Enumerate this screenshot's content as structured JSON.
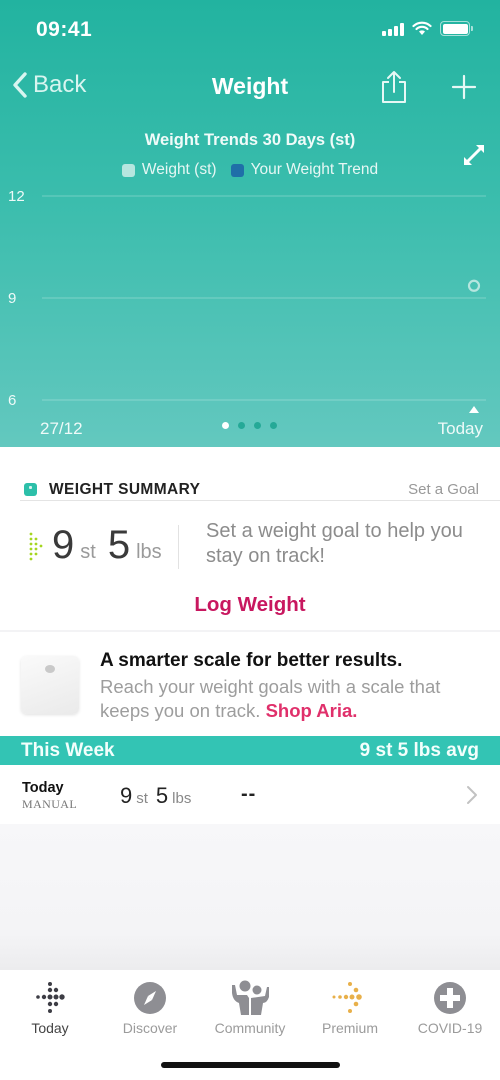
{
  "status_bar": {
    "time": "09:41"
  },
  "nav": {
    "back_label": "Back",
    "title": "Weight",
    "icons": {
      "back": "chevron-left-icon",
      "share": "share-icon",
      "add": "plus-icon"
    }
  },
  "chart_data": {
    "type": "scatter",
    "title": "Weight Trends 30 Days (st)",
    "legend": [
      {
        "name": "Weight (st)",
        "color": "#b6e6df"
      },
      {
        "name": "Your Weight Trend",
        "color": "#1f6fa8"
      }
    ],
    "legend_placement": "top",
    "xlabel": "",
    "ylabel": "",
    "x_ticks": [
      "27/12",
      "Today"
    ],
    "y_ticks": [
      12,
      9,
      6
    ],
    "ylim": [
      6,
      12
    ],
    "grid": true,
    "series": [
      {
        "name": "Weight (st)",
        "points": [
          {
            "x": "Today",
            "y": 9.36
          }
        ]
      },
      {
        "name": "Your Weight Trend",
        "points": []
      }
    ],
    "pages": 4,
    "active_page": 1
  },
  "summary": {
    "title": "WEIGHT SUMMARY",
    "set_goal": "Set a Goal",
    "stones": "9",
    "stones_unit": "st",
    "pounds": "5",
    "pounds_unit": "lbs",
    "goal_message": "Set a weight goal to help you stay on track!",
    "log_weight": "Log Weight"
  },
  "promo": {
    "title": "A smarter scale for better results.",
    "body": "Reach your weight goals with a scale that keeps you on track.",
    "link": "Shop Aria."
  },
  "week": {
    "label": "This Week",
    "average": "9 st 5 lbs avg"
  },
  "entries": [
    {
      "day": "Today",
      "source": "MANUAL",
      "stones": "9",
      "stones_unit": "st",
      "pounds": "5",
      "pounds_unit": "lbs",
      "secondary": "--"
    }
  ],
  "tabs": [
    {
      "label": "Today",
      "icon": "fitbit-logo-icon",
      "active": true
    },
    {
      "label": "Discover",
      "icon": "compass-icon",
      "active": false
    },
    {
      "label": "Community",
      "icon": "community-icon",
      "active": false
    },
    {
      "label": "Premium",
      "icon": "premium-icon",
      "active": false
    },
    {
      "label": "COVID-19",
      "icon": "medical-cross-icon",
      "active": false
    }
  ],
  "colors": {
    "brand_teal": "#2cbfa9",
    "accent_pink": "#c8175f",
    "link_pink": "#e0306b",
    "premium_gold": "#e8b04a"
  }
}
